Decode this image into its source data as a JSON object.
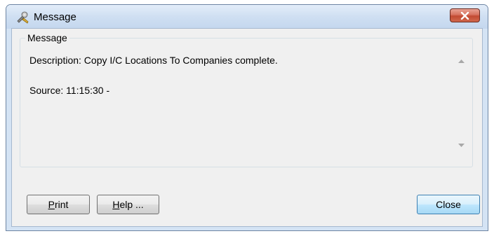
{
  "window": {
    "title": "Message",
    "icon": "wrench-tools-icon",
    "close_icon": "close-x-icon"
  },
  "group": {
    "legend": "Message"
  },
  "message": {
    "description": "Description: Copy I/C Locations To Companies complete.",
    "source": "Source:  11:15:30 -"
  },
  "buttons": {
    "print": {
      "accel": "P",
      "rest": "rint"
    },
    "help": {
      "accel": "H",
      "rest": "elp ..."
    },
    "close": "Close"
  },
  "colors": {
    "accent_close": "#c24a32",
    "frame": "#d4e3f4"
  }
}
